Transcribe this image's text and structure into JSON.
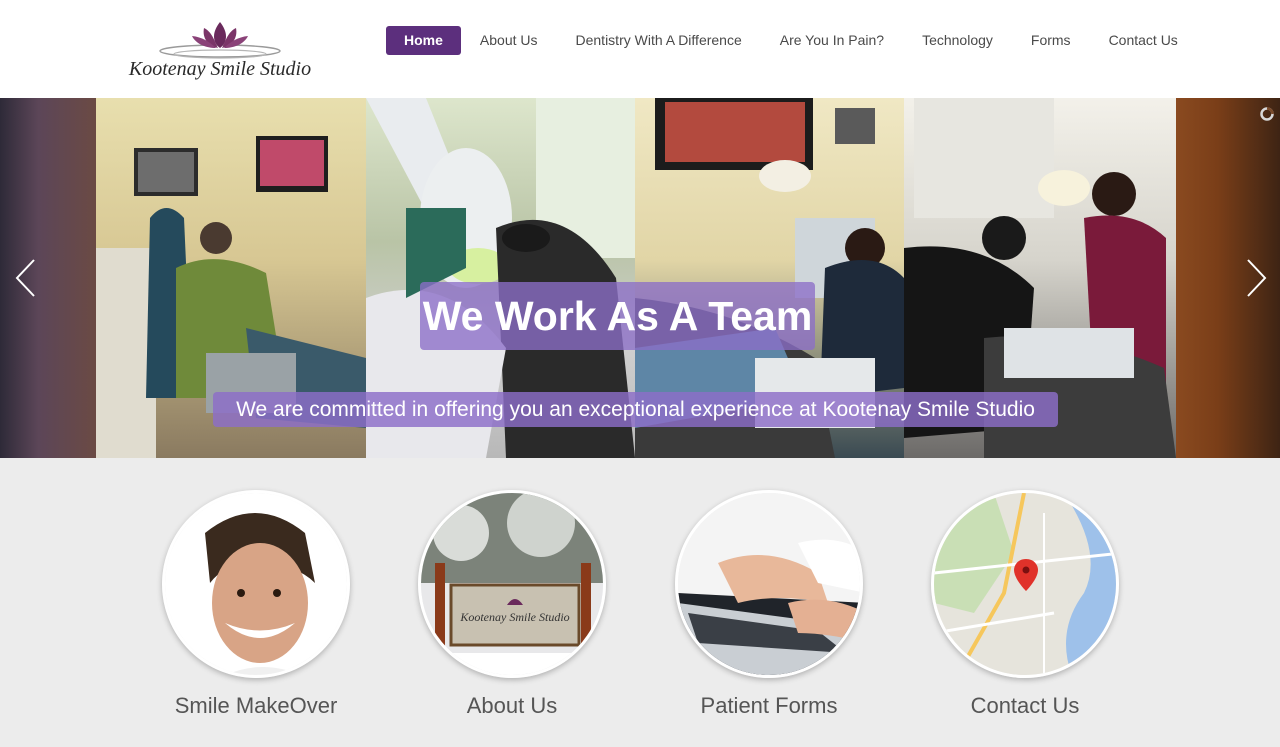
{
  "brand": {
    "name": "Kootenay Smile Studio",
    "accent": "#5c2f7d"
  },
  "nav": {
    "items": [
      {
        "label": "Home",
        "active": true
      },
      {
        "label": "About Us"
      },
      {
        "label": "Dentistry With A Difference"
      },
      {
        "label": "Are You In Pain?"
      },
      {
        "label": "Technology"
      },
      {
        "label": "Forms"
      },
      {
        "label": "Contact Us"
      }
    ]
  },
  "hero": {
    "title": "We Work As A Team",
    "subtitle": "We are committed in offering you an exceptional experience at Kootenay Smile Studio",
    "prev_icon": "chevron-left-icon",
    "next_icon": "chevron-right-icon",
    "loader_icon": "loading-spinner-icon",
    "overlay_color": "#8c6ec8"
  },
  "features": [
    {
      "label": "Smile MakeOver",
      "icon": "smiling-man-photo"
    },
    {
      "label": "About Us",
      "icon": "office-sign-photo"
    },
    {
      "label": "Patient Forms",
      "icon": "laptop-typing-photo"
    },
    {
      "label": "Contact Us",
      "icon": "map-pin-photo"
    }
  ]
}
